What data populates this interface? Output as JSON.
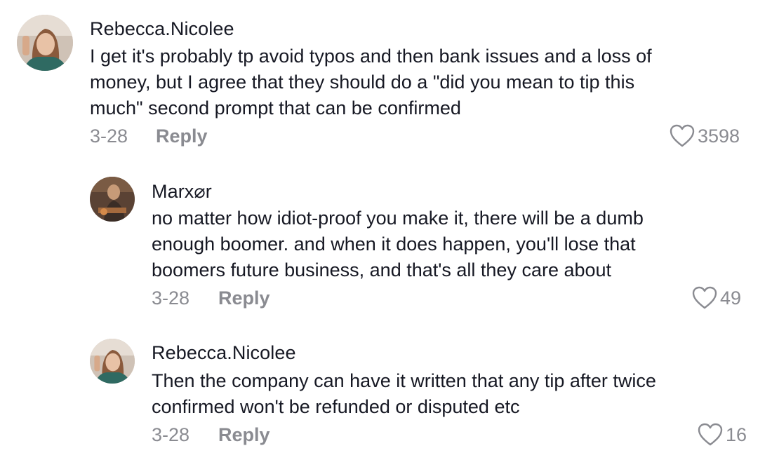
{
  "comments": [
    {
      "username": "Rebecca.Nicolee",
      "lines": [
        "I get it's probably tp avoid typos and then bank issues and a loss of",
        "money, but I agree that they should do a \"did you mean to tip this",
        "much\" second prompt that can be confirmed"
      ],
      "date": "3-28",
      "reply_label": "Reply",
      "likes": "3598",
      "avatar_icon": "user-avatar-photo"
    },
    {
      "username": "Marx⌀r",
      "lines": [
        "no matter how idiot-proof you make it, there will be a dumb",
        "enough boomer. and when it does happen, you'll lose that",
        "boomers future business, and that's all they care about"
      ],
      "date": "3-28",
      "reply_label": "Reply",
      "likes": "49",
      "avatar_icon": "user-avatar-photo"
    },
    {
      "username": "Rebecca.Nicolee",
      "lines": [
        "Then the company can have it written that any tip after twice",
        "confirmed won't be refunded or disputed etc"
      ],
      "date": "3-28",
      "reply_label": "Reply",
      "likes": "16",
      "avatar_icon": "user-avatar-photo"
    }
  ],
  "colors": {
    "text_primary": "#161823",
    "text_secondary": "#8a8b91",
    "background": "#ffffff"
  },
  "icons": {
    "like": "heart-outline-icon"
  }
}
